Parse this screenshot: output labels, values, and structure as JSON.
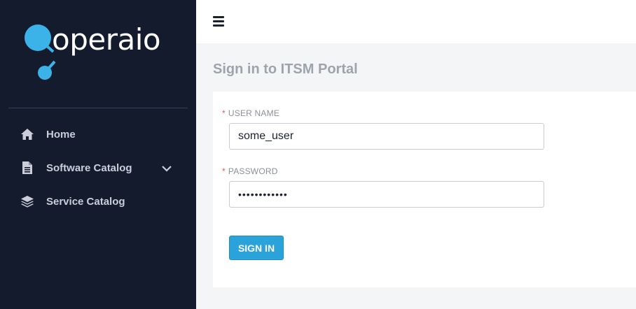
{
  "brand": {
    "logo_text": "operaio",
    "logo_color": "#3bb3e8"
  },
  "sidebar": {
    "items": [
      {
        "label": "Home",
        "icon": "home-icon"
      },
      {
        "label": "Software Catalog",
        "icon": "document-icon",
        "expandable": true
      },
      {
        "label": "Service Catalog",
        "icon": "layers-icon"
      }
    ]
  },
  "page": {
    "title": "Sign in to ITSM Portal"
  },
  "form": {
    "required_mark": "*",
    "username_label": "USER NAME",
    "username_value": "some_user",
    "password_label": "PASSWORD",
    "password_value": "••••••••••••",
    "submit_label": "SIGN IN"
  },
  "colors": {
    "sidebar_bg": "#141b2d",
    "accent": "#2aa3db",
    "required": "#e05a5a"
  }
}
